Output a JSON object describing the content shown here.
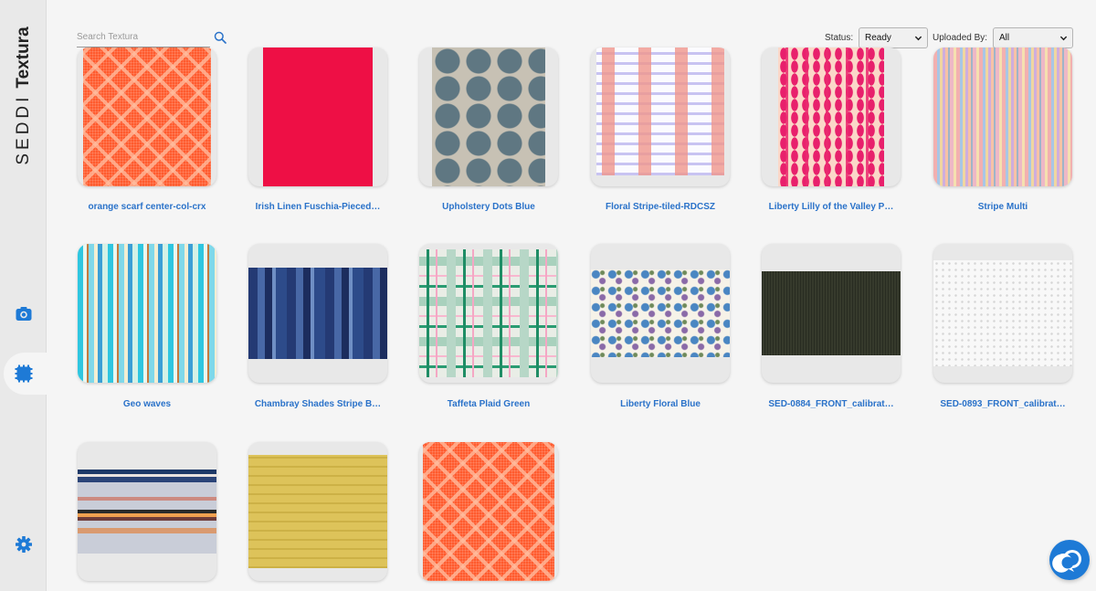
{
  "app": {
    "logo_light": "SEDDI",
    "logo_bold": "Textura"
  },
  "sidebar": {
    "items": [
      {
        "icon": "camera-icon"
      },
      {
        "icon": "fabric-swatch-icon",
        "active": true
      },
      {
        "icon": "gear-icon"
      }
    ]
  },
  "search": {
    "placeholder": "Search Textura",
    "value": ""
  },
  "filters": {
    "status_label": "Status:",
    "status_value": "Ready",
    "uploaded_label": "Uploaded By:",
    "uploaded_value": "All"
  },
  "materials": [
    {
      "name": "orange scarf center-col-crx",
      "texture": "orange"
    },
    {
      "name": "Irish Linen Fuschia-Pieced…",
      "texture": "fuchsia"
    },
    {
      "name": "Upholstery Dots Blue",
      "texture": "dots"
    },
    {
      "name": "Floral Stripe-tiled-RDCSZ",
      "texture": "floral"
    },
    {
      "name": "Liberty Lilly of the Valley P…",
      "texture": "liberty"
    },
    {
      "name": "Stripe Multi",
      "texture": "stripe"
    },
    {
      "name": "Geo waves",
      "texture": "geo"
    },
    {
      "name": "Chambray Shades Stripe B…",
      "texture": "chambray"
    },
    {
      "name": "Taffeta Plaid Green",
      "texture": "plaid"
    },
    {
      "name": "Liberty Floral Blue",
      "texture": "libblue"
    },
    {
      "name": "SED-0884_FRONT_calibrat…",
      "texture": "dark"
    },
    {
      "name": "SED-0893_FRONT_calibrat…",
      "texture": "white"
    },
    {
      "name": "",
      "texture": "fairisle"
    },
    {
      "name": "",
      "texture": "yellow"
    },
    {
      "name": "",
      "texture": "orange"
    }
  ],
  "colors": {
    "accent": "#2a72c9",
    "chat": "#1e7ad6"
  }
}
